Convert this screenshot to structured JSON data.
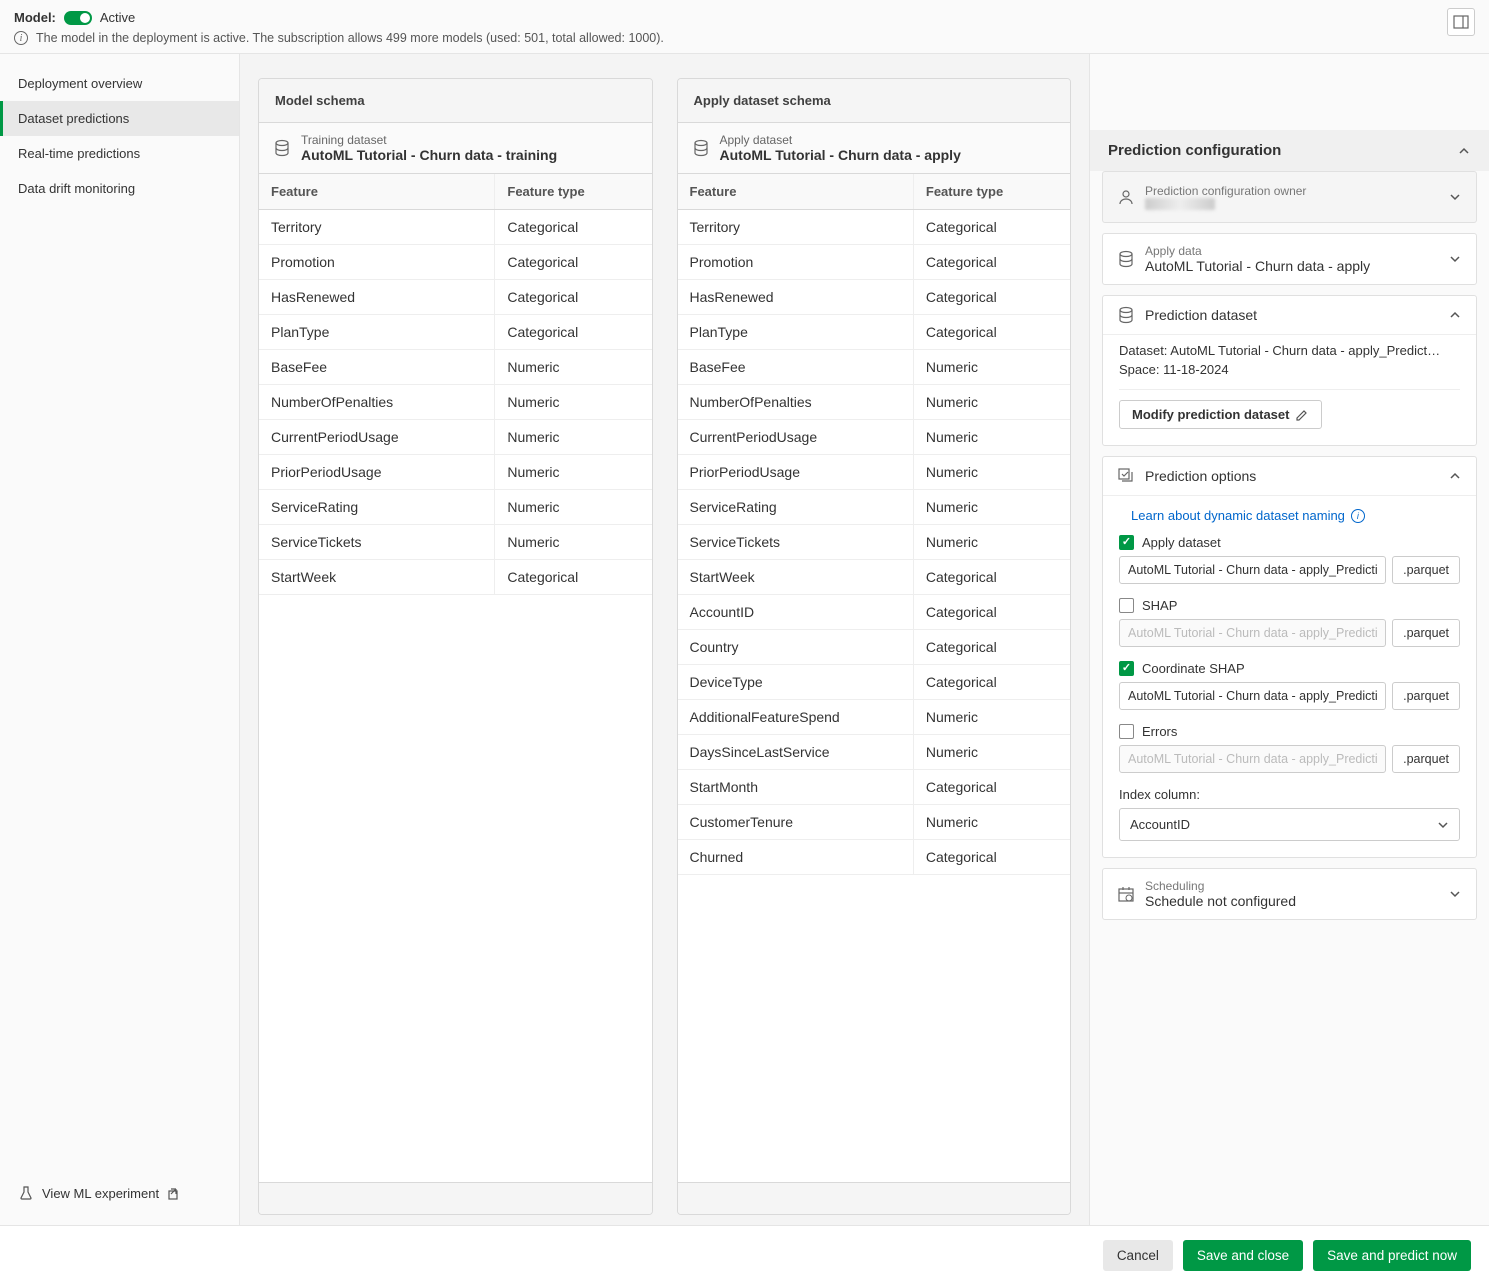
{
  "topbar": {
    "model_label": "Model:",
    "status": "Active",
    "message": "The model in the deployment is active. The subscription allows 499 more models (used: 501, total allowed: 1000)."
  },
  "sidebar": {
    "items": [
      {
        "label": "Deployment overview",
        "active": false
      },
      {
        "label": "Dataset predictions",
        "active": true
      },
      {
        "label": "Real-time predictions",
        "active": false
      },
      {
        "label": "Data drift monitoring",
        "active": false
      }
    ],
    "footer": "View ML experiment"
  },
  "model_schema": {
    "title": "Model schema",
    "sub_label": "Training dataset",
    "sub_value": "AutoML Tutorial - Churn data - training",
    "col_feature": "Feature",
    "col_type": "Feature type",
    "rows": [
      {
        "f": "Territory",
        "t": "Categorical"
      },
      {
        "f": "Promotion",
        "t": "Categorical"
      },
      {
        "f": "HasRenewed",
        "t": "Categorical"
      },
      {
        "f": "PlanType",
        "t": "Categorical"
      },
      {
        "f": "BaseFee",
        "t": "Numeric"
      },
      {
        "f": "NumberOfPenalties",
        "t": "Numeric"
      },
      {
        "f": "CurrentPeriodUsage",
        "t": "Numeric"
      },
      {
        "f": "PriorPeriodUsage",
        "t": "Numeric"
      },
      {
        "f": "ServiceRating",
        "t": "Numeric"
      },
      {
        "f": "ServiceTickets",
        "t": "Numeric"
      },
      {
        "f": "StartWeek",
        "t": "Categorical"
      }
    ]
  },
  "apply_schema": {
    "title": "Apply dataset schema",
    "sub_label": "Apply dataset",
    "sub_value": "AutoML Tutorial - Churn data - apply",
    "col_feature": "Feature",
    "col_type": "Feature type",
    "rows": [
      {
        "f": "Territory",
        "t": "Categorical"
      },
      {
        "f": "Promotion",
        "t": "Categorical"
      },
      {
        "f": "HasRenewed",
        "t": "Categorical"
      },
      {
        "f": "PlanType",
        "t": "Categorical"
      },
      {
        "f": "BaseFee",
        "t": "Numeric"
      },
      {
        "f": "NumberOfPenalties",
        "t": "Numeric"
      },
      {
        "f": "CurrentPeriodUsage",
        "t": "Numeric"
      },
      {
        "f": "PriorPeriodUsage",
        "t": "Numeric"
      },
      {
        "f": "ServiceRating",
        "t": "Numeric"
      },
      {
        "f": "ServiceTickets",
        "t": "Numeric"
      },
      {
        "f": "StartWeek",
        "t": "Categorical"
      },
      {
        "f": "AccountID",
        "t": "Categorical"
      },
      {
        "f": "Country",
        "t": "Categorical"
      },
      {
        "f": "DeviceType",
        "t": "Categorical"
      },
      {
        "f": "AdditionalFeatureSpend",
        "t": "Numeric"
      },
      {
        "f": "DaysSinceLastService",
        "t": "Numeric"
      },
      {
        "f": "StartMonth",
        "t": "Categorical"
      },
      {
        "f": "CustomerTenure",
        "t": "Numeric"
      },
      {
        "f": "Churned",
        "t": "Categorical"
      }
    ]
  },
  "right": {
    "title": "Prediction configuration",
    "owner": {
      "label": "Prediction configuration owner"
    },
    "apply_data": {
      "label": "Apply data",
      "value": "AutoML Tutorial - Churn data - apply"
    },
    "pred_dataset": {
      "label": "Prediction dataset",
      "dataset": "Dataset: AutoML Tutorial - Churn data - apply_Predict…",
      "space": "Space: 11-18-2024",
      "modify_btn": "Modify prediction dataset"
    },
    "pred_options": {
      "label": "Prediction options",
      "link": "Learn about dynamic dataset naming",
      "options": [
        {
          "name": "Apply dataset",
          "checked": true,
          "file": "AutoML Tutorial - Churn data - apply_Predicti",
          "ext": ".parquet",
          "enabled": true
        },
        {
          "name": "SHAP",
          "checked": false,
          "file": "AutoML Tutorial - Churn data - apply_Predicti",
          "ext": ".parquet",
          "enabled": false
        },
        {
          "name": "Coordinate SHAP",
          "checked": true,
          "file": "AutoML Tutorial - Churn data - apply_Predicti",
          "ext": ".parquet",
          "enabled": true
        },
        {
          "name": "Errors",
          "checked": false,
          "file": "AutoML Tutorial - Churn data - apply_Predicti",
          "ext": ".parquet",
          "enabled": false
        }
      ],
      "index_label": "Index column:",
      "index_value": "AccountID"
    },
    "scheduling": {
      "label": "Scheduling",
      "value": "Schedule not configured"
    }
  },
  "footer": {
    "cancel": "Cancel",
    "save_close": "Save and close",
    "save_predict": "Save and predict now"
  }
}
